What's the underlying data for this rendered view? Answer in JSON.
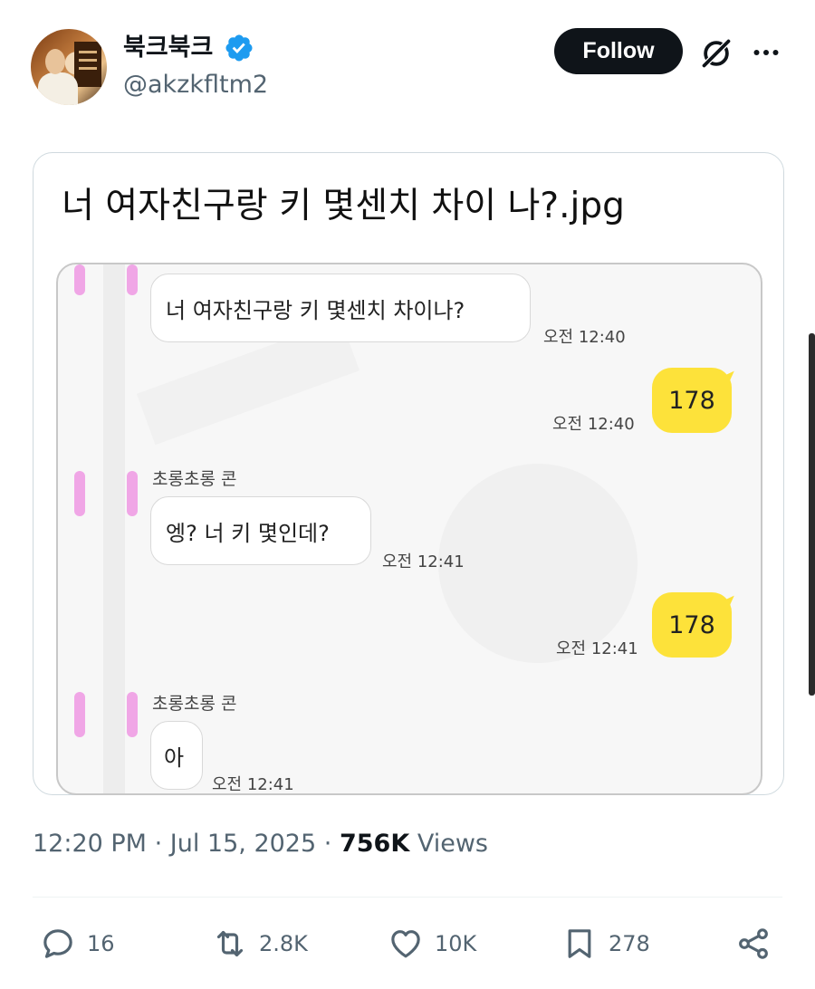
{
  "author": {
    "display_name": "북크북크",
    "handle": "@akzkfltm2",
    "verified": true
  },
  "header": {
    "follow_label": "Follow",
    "grok_icon": "grok-icon",
    "more_icon": "more-icon"
  },
  "post": {
    "image_title": "너 여자친구랑 키 몇센치 차이 나?.jpg",
    "chat": {
      "messages": [
        {
          "side": "in",
          "text": "너 여자친구랑 키 몇센치 차이나?",
          "time": "오전 12:40"
        },
        {
          "side": "out",
          "text": "178",
          "time": "오전 12:40"
        },
        {
          "side": "in",
          "sender": "초롱초롱 콘",
          "text": "엥? 너 키 몇인데?",
          "time": "오전 12:41"
        },
        {
          "side": "out",
          "text": "178",
          "time": "오전 12:41"
        },
        {
          "side": "in",
          "sender": "초롱초롱 콘",
          "text": "아",
          "time": "오전 12:41"
        }
      ]
    }
  },
  "meta": {
    "time": "12:20 PM",
    "date": "Jul 15, 2025",
    "views_count": "756K",
    "views_label": "Views",
    "sep": "·"
  },
  "actions": {
    "replies": "16",
    "reposts": "2.8K",
    "likes": "10K",
    "bookmarks": "278"
  },
  "colors": {
    "verified_blue": "#1d9bf0",
    "kakao_yellow": "#fde23a",
    "secondary_text": "#536471"
  }
}
